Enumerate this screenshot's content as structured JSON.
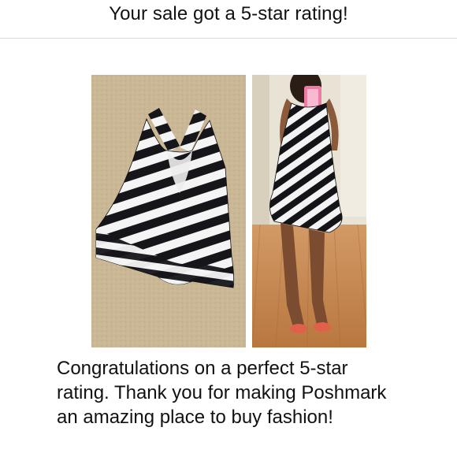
{
  "header": {
    "title": "Your sale got a 5-star rating!"
  },
  "photos": [
    {
      "subject": "striped-dress-flat-on-carpet"
    },
    {
      "subject": "striped-dress-worn-mirror-selfie"
    }
  ],
  "message": {
    "text": "Congratulations on a perfect 5-star rating. Thank you for making Poshmark an amazing place to buy fashion!"
  },
  "colors": {
    "text": "#111111",
    "divider": "#d9d9d9",
    "stripe_dark": "#15151a",
    "stripe_light": "#f4f4f4",
    "carpet": "#c9b795",
    "floor": "#c98e5a",
    "wall": "#e9e3d6"
  }
}
